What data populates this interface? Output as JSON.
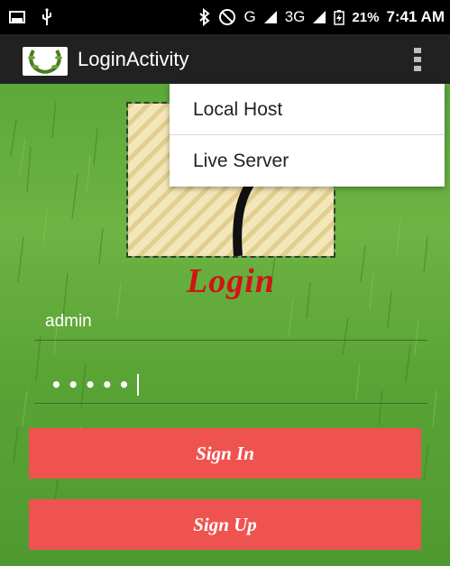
{
  "status_bar": {
    "carrier_indicators": "G",
    "network_type": "3G",
    "battery_percent": "21%",
    "time": "7:41 AM",
    "icons": [
      "screenshot-icon",
      "usb-icon",
      "bluetooth-icon",
      "do-not-disturb-icon",
      "signal-icon",
      "battery-charging-icon"
    ]
  },
  "action_bar": {
    "title": "LoginActivity",
    "logo": "laurel-wreath-logo",
    "overflow_icon": "overflow-menu-icon"
  },
  "login": {
    "heading": "Login",
    "username_value": "admin",
    "password_masked": "•••••",
    "sign_in_label": "Sign In",
    "sign_up_label": "Sign Up"
  },
  "overflow_menu": {
    "items": [
      {
        "label": "Local Host"
      },
      {
        "label": "Live Server"
      }
    ]
  },
  "colors": {
    "button_bg": "#ef5350",
    "heading": "#d11414",
    "action_bar": "#212121",
    "background_grass": "#5da83a"
  }
}
